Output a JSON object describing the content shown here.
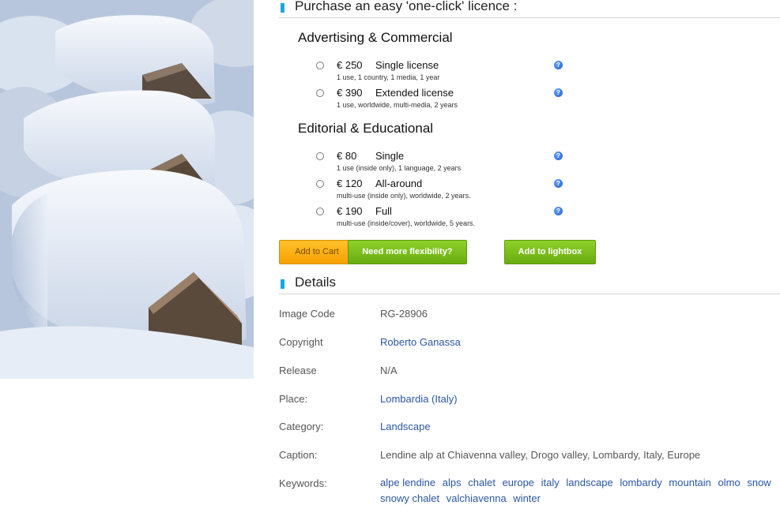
{
  "purchase": {
    "title": "Purchase an easy 'one-click' licence :",
    "groups": [
      {
        "title": "Advertising & Commercial",
        "options": [
          {
            "price": "€ 250",
            "name": "Single license",
            "desc": "1 use, 1 country, 1 media, 1 year"
          },
          {
            "price": "€ 390",
            "name": "Extended license",
            "desc": "1 use, worldwide, multi-media, 2 years"
          }
        ]
      },
      {
        "title": "Editorial & Educational",
        "options": [
          {
            "price": "€ 80",
            "name": "Single",
            "desc": "1 use (inside only), 1 language, 2 years"
          },
          {
            "price": "€ 120",
            "name": "All-around",
            "desc": "multi-use (inside only), worldwide, 2 years."
          },
          {
            "price": "€ 190",
            "name": "Full",
            "desc": "multi-use (inside/cover), worldwide, 5 years."
          }
        ]
      }
    ],
    "buttons": {
      "cart": "Add to Cart",
      "flex": "Need more flexibility?",
      "lightbox": "Add to lightbox"
    },
    "help_glyph": "?"
  },
  "details": {
    "title": "Details",
    "rows": [
      {
        "label": "Image Code",
        "value": "RG-28906"
      },
      {
        "label": "Copyright",
        "value": "Roberto Ganassa"
      },
      {
        "label": "Release",
        "value": "N/A"
      },
      {
        "label": "Place:",
        "value": "Lombardia (Italy)"
      },
      {
        "label": "Category:",
        "value": "Landscape"
      },
      {
        "label": "Caption:",
        "value": "Lendine alp at Chiavenna valley, Drogo valley, Lombardy, Italy, Europe"
      },
      {
        "label": "Keywords:",
        "value": ""
      }
    ],
    "keywords": [
      "alpe lendine",
      "alps",
      "chalet",
      "europe",
      "italy",
      "landscape",
      "lombardy",
      "mountain",
      "olmo",
      "snow",
      "snowy chalet",
      "valchiavenna",
      "winter"
    ]
  },
  "colors": {
    "accent_marker": "#18a8e0",
    "link": "#2a56a6",
    "cart_button": "#f7a100",
    "green_button": "#6aac10"
  }
}
